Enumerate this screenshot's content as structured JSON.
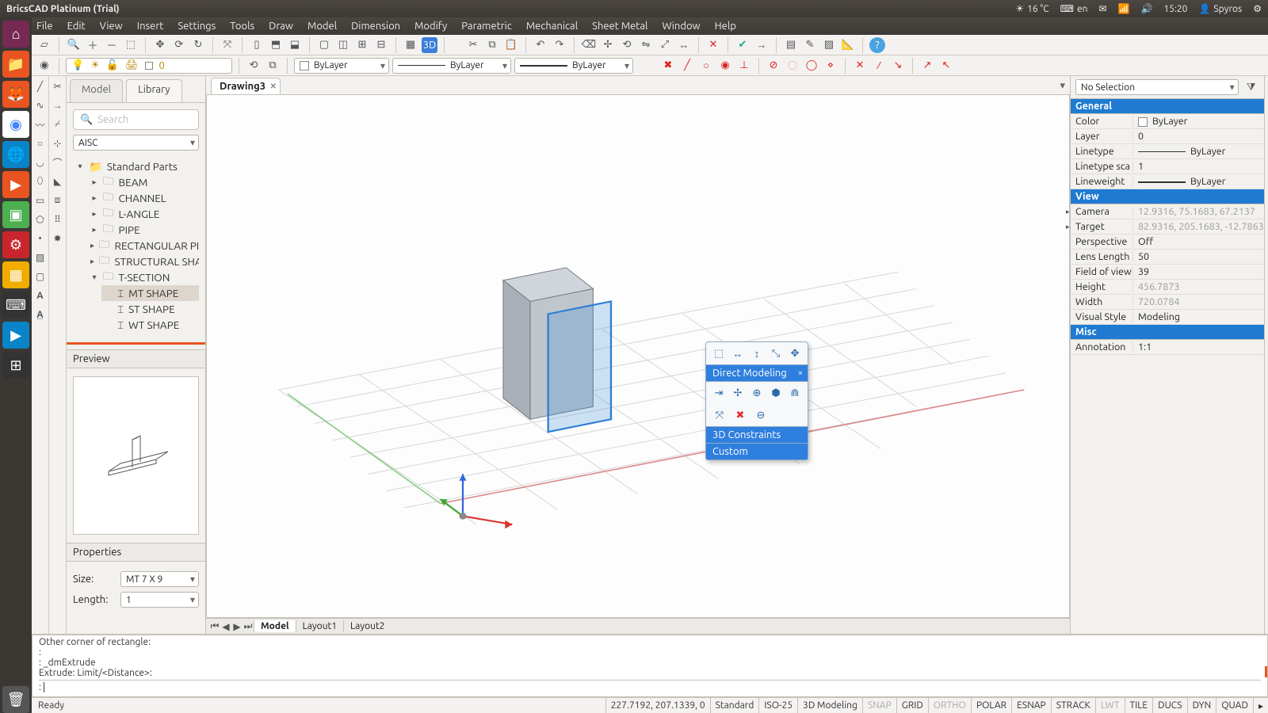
{
  "ubuntu": {
    "title": "BricsCAD Platinum (Trial)",
    "temp": "16 °C",
    "kbd": "en",
    "time": "15:20",
    "user": "Spyros"
  },
  "menu": {
    "items": [
      "File",
      "Edit",
      "View",
      "Insert",
      "Settings",
      "Tools",
      "Draw",
      "Model",
      "Dimension",
      "Modify",
      "Parametric",
      "Mechanical",
      "Sheet Metal",
      "Window",
      "Help"
    ]
  },
  "layerbar": {
    "layer_value": "0",
    "layer_control_label": "0",
    "color_label": "ByLayer",
    "linetype_label": "ByLayer",
    "lineweight_label": "ByLayer"
  },
  "panel": {
    "tabs": {
      "model": "Model",
      "library": "Library"
    },
    "search_placeholder": "Search",
    "catalog": "AISC",
    "tree": {
      "root": "Standard Parts",
      "items": [
        "BEAM",
        "CHANNEL",
        "L-ANGLE",
        "PIPE",
        "RECTANGULAR PIPE",
        "STRUCTURAL SHAPE",
        "T-SECTION"
      ],
      "tsection_children": [
        "MT SHAPE",
        "ST SHAPE",
        "WT SHAPE"
      ],
      "selected": "MT SHAPE"
    },
    "preview_label": "Preview",
    "properties_label": "Properties",
    "props": {
      "size_label": "Size:",
      "size_value": "MT 7 X 9",
      "length_label": "Length:",
      "length_value": "1"
    }
  },
  "doc": {
    "tab": "Drawing3"
  },
  "layout_tabs": {
    "model": "Model",
    "l1": "Layout1",
    "l2": "Layout2"
  },
  "quad": {
    "title": "Direct Modeling",
    "constraints": "3D Constraints",
    "custom": "Custom"
  },
  "cmd": {
    "line0": "Other corner of rectangle:",
    "line1": ":",
    "line2": ": _dmExtrude",
    "line3": "Extrude: Limit/<Distance>:",
    "prompt": ": "
  },
  "status": {
    "ready": "Ready",
    "coords": "227.7192, 207.1339, 0",
    "std": "Standard",
    "iso": "ISO-25",
    "ws": "3D Modeling",
    "toggles": [
      "SNAP",
      "GRID",
      "ORTHO",
      "POLAR",
      "ESNAP",
      "STRACK",
      "LWT",
      "TILE",
      "DUCS",
      "DYN",
      "QUAD"
    ],
    "toggles_dim": [
      "SNAP",
      "ORTHO",
      "LWT"
    ]
  },
  "right": {
    "selection": "No Selection",
    "general_label": "General",
    "general": {
      "Color": "ByLayer",
      "Layer": "0",
      "Linetype": "ByLayer",
      "Linetype_scale_label": "Linetype sca",
      "Linetype_scale": "1",
      "Lineweight": "ByLayer"
    },
    "view_label": "View",
    "view": {
      "Camera": "12.9316, 75.1683, 67.2137",
      "Target": "82.9316, 205.1683, -12.7863",
      "Perspective": "Off",
      "Lens_label": "Lens Length",
      "Lens": "50",
      "Fov_label": "Field of view",
      "Fov": "39",
      "Height": "456.7873",
      "Width": "720.0784",
      "Visual_label": "Visual Style",
      "Visual": "Modeling"
    },
    "misc_label": "Misc",
    "misc": {
      "Annotation_label": "Annotation",
      "Annotation": "1:1"
    }
  }
}
